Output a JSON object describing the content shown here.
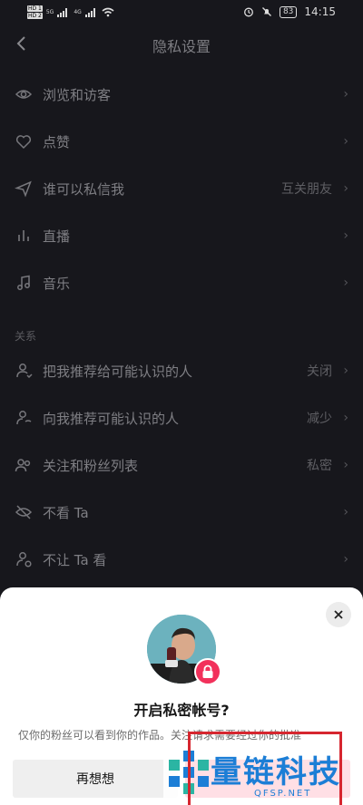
{
  "status_bar": {
    "hd1": "HD 1",
    "hd2": "HD 2",
    "net1": "5G",
    "net2": "4G",
    "battery": "83",
    "time": "14:15"
  },
  "header": {
    "title": "隐私设置"
  },
  "settings": [
    {
      "label": "浏览和访客",
      "value": "",
      "icon": "eye-icon"
    },
    {
      "label": "点赞",
      "value": "",
      "icon": "heart-icon"
    },
    {
      "label": "谁可以私信我",
      "value": "互关朋友",
      "icon": "send-icon"
    },
    {
      "label": "直播",
      "value": "",
      "icon": "bars-icon"
    },
    {
      "label": "音乐",
      "value": "",
      "icon": "music-note-icon"
    }
  ],
  "section_label": "关系",
  "relations": [
    {
      "label": "把我推荐给可能认识的人",
      "value": "关闭",
      "icon": "user-recommend-icon"
    },
    {
      "label": "向我推荐可能认识的人",
      "value": "减少",
      "icon": "user-discover-icon"
    },
    {
      "label": "关注和粉丝列表",
      "value": "私密",
      "icon": "users-icon"
    },
    {
      "label": "不看 Ta",
      "value": "",
      "icon": "eye-off-icon"
    },
    {
      "label": "不让 Ta 看",
      "value": "",
      "icon": "user-block-icon"
    }
  ],
  "sheet": {
    "title": "开启私密帐号?",
    "description": "仅你的粉丝可以看到你的作品。关注请求需要经过你的批准",
    "cancel_label": "再想想",
    "confirm_label": ""
  },
  "watermark": {
    "text": "量链科技",
    "sub": "QFSP.NET"
  },
  "colors": {
    "accent": "#fe2c55",
    "badge": "#f2315b",
    "watermark": "#1c7ed6"
  }
}
